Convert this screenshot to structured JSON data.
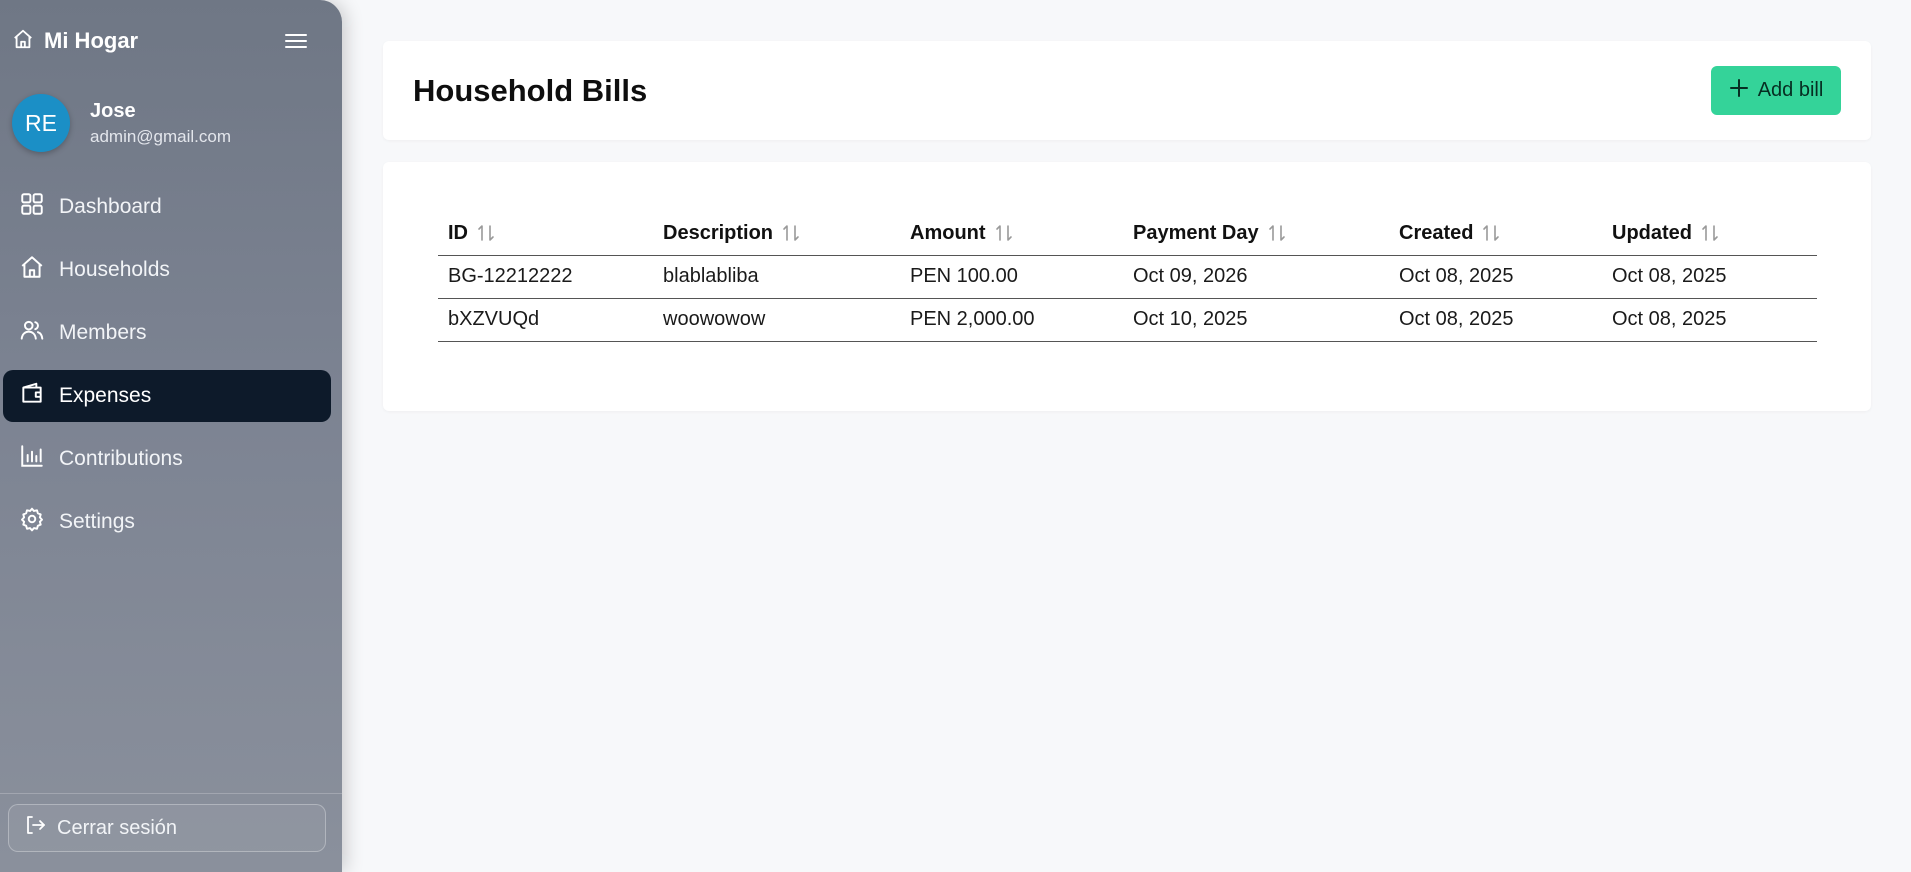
{
  "sidebar": {
    "brand": "Mi Hogar",
    "user": {
      "initials": "RE",
      "name": "Jose",
      "email": "admin@gmail.com"
    },
    "items": [
      {
        "label": "Dashboard",
        "icon": "grid-icon"
      },
      {
        "label": "Households",
        "icon": "home-icon"
      },
      {
        "label": "Members",
        "icon": "users-icon"
      },
      {
        "label": "Expenses",
        "icon": "wallet-icon",
        "active": true
      },
      {
        "label": "Contributions",
        "icon": "bar-chart-icon"
      },
      {
        "label": "Settings",
        "icon": "gear-icon"
      }
    ],
    "logout": "Cerrar sesión"
  },
  "header": {
    "title": "Household Bills",
    "add_button": "Add bill"
  },
  "table": {
    "columns": [
      "ID",
      "Description",
      "Amount",
      "Payment Day",
      "Created",
      "Updated"
    ],
    "rows": [
      [
        "BG-12212222",
        "blablabliba",
        "PEN 100.00",
        "Oct 09, 2026",
        "Oct 08, 2025",
        "Oct 08, 2025"
      ],
      [
        "bXZVUQd",
        "woowowow",
        "PEN 2,000.00",
        "Oct 10, 2025",
        "Oct 08, 2025",
        "Oct 08, 2025"
      ]
    ]
  },
  "colors": {
    "accent": "#34d399",
    "sidebar": "#7c8392",
    "active_item": "#0d1a2a",
    "avatar": "#1b8fc6"
  }
}
